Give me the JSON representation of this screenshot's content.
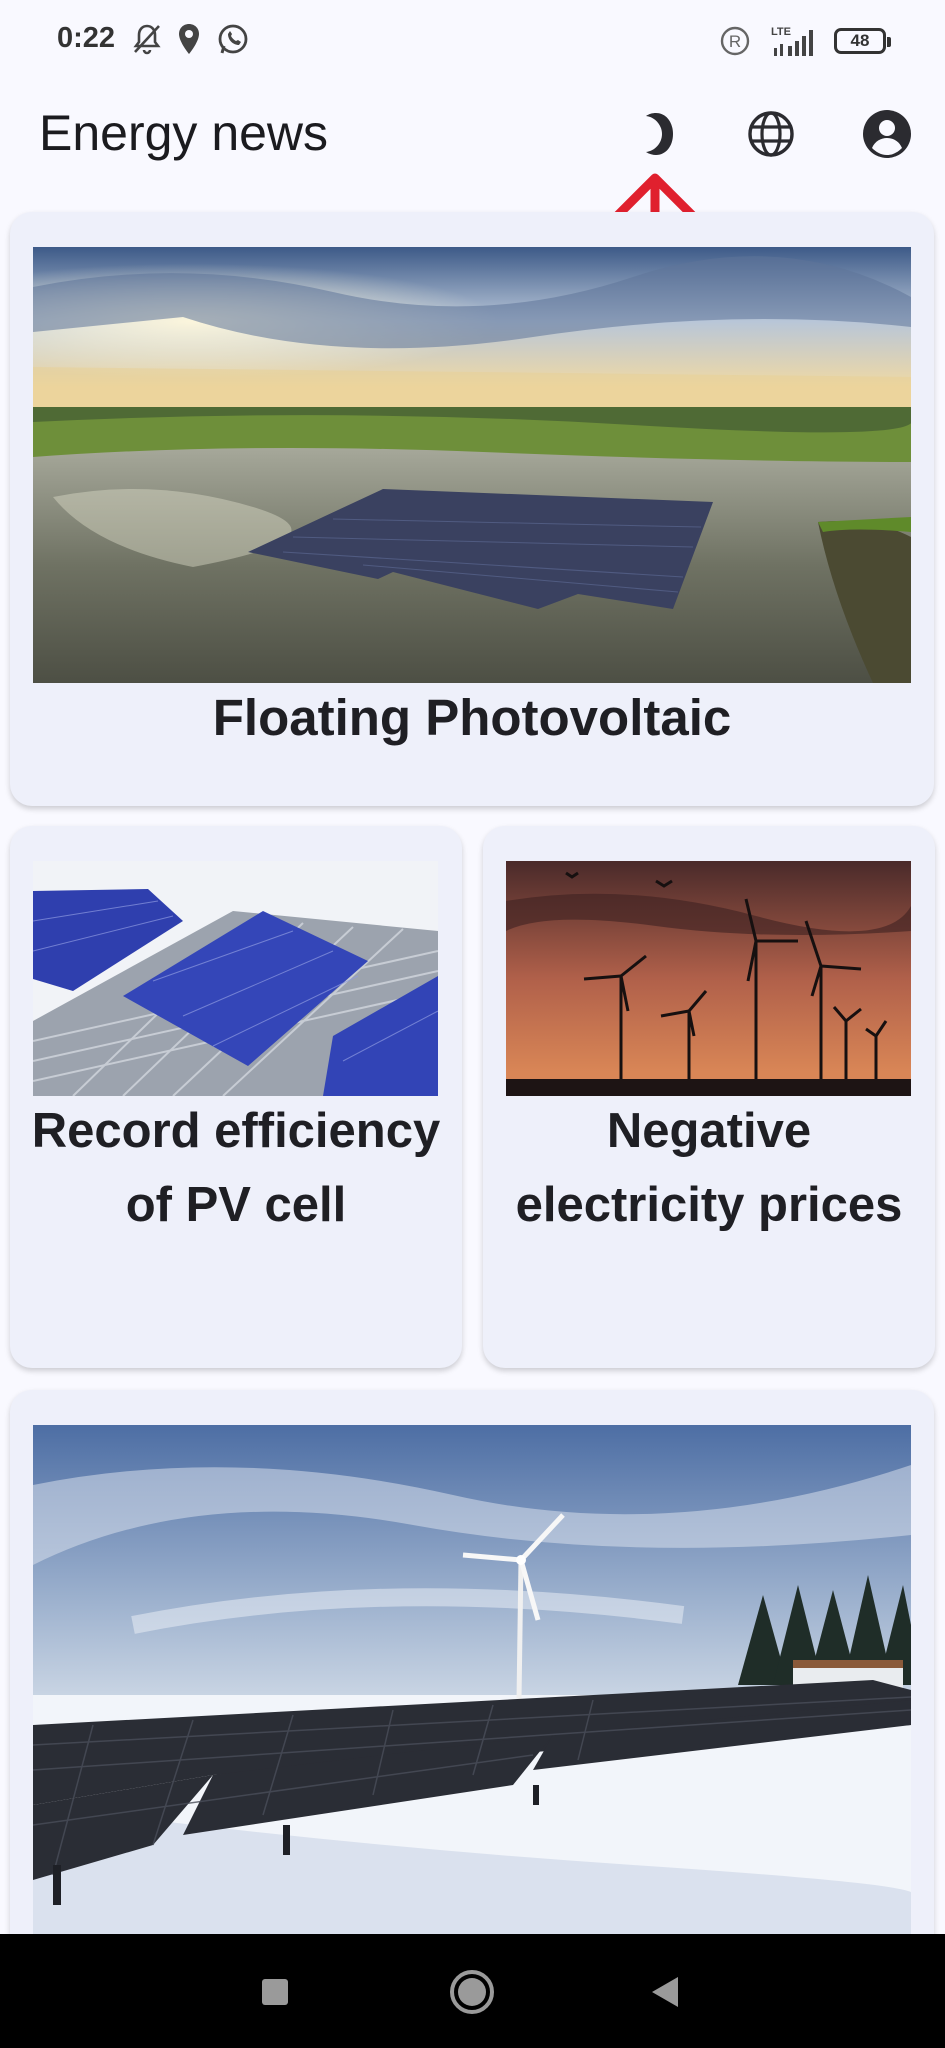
{
  "status_bar": {
    "time": "0:22",
    "network": "LTE",
    "battery": "48",
    "icons": [
      "bell-off-icon",
      "location-pin-icon",
      "whatsapp-icon",
      "registered-icon",
      "signal-icon",
      "battery-icon"
    ]
  },
  "app_bar": {
    "title": "Energy news",
    "actions": [
      "dark-mode-moon-icon",
      "language-globe-icon",
      "account-icon"
    ]
  },
  "annotation": {
    "arrow_color": "#e0202e"
  },
  "articles": [
    {
      "title": "Floating Photovoltaic",
      "image": "floating-solar-panels-on-lake"
    },
    {
      "title": "Record efficiency of PV cell",
      "image": "solar-cell-closeup"
    },
    {
      "title": "Negative electricity prices",
      "image": "wind-turbines-at-sunset"
    },
    {
      "title": "",
      "image": "solar-park-in-snow-with-wind-turbine"
    }
  ],
  "nav_bar": {
    "buttons": [
      "recent-apps-square-icon",
      "home-circle-icon",
      "back-triangle-icon"
    ]
  }
}
